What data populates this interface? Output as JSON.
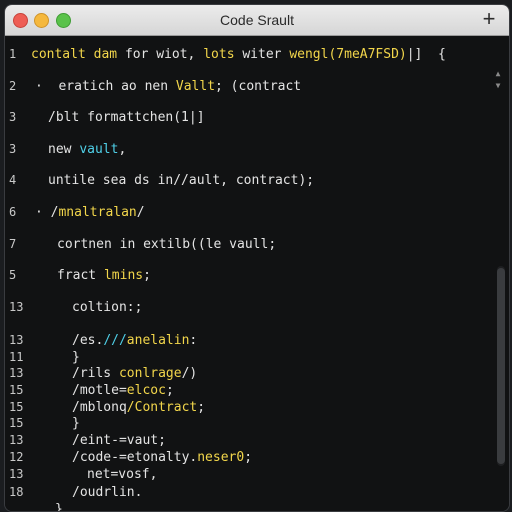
{
  "window": {
    "title": "Code Srault",
    "new_tab_label": "+"
  },
  "editor": {
    "lines": [
      {
        "num": "1",
        "tokens": [
          {
            "t": "contalt ",
            "c": "y"
          },
          {
            "t": "dam ",
            "c": "y"
          },
          {
            "t": "for ",
            "c": "w"
          },
          {
            "t": "wiot, ",
            "c": "w"
          },
          {
            "t": "lots ",
            "c": "y"
          },
          {
            "t": "witer ",
            "c": "w"
          },
          {
            "t": "wengl(7meA7FSD)",
            "c": "y"
          },
          {
            "t": "|]  {",
            "c": "w"
          }
        ]
      },
      {
        "num": "2",
        "tokens": [
          {
            "t": "·  ",
            "c": "w"
          },
          {
            "t": "eratich ao nen ",
            "c": "w"
          },
          {
            "t": "Vallt",
            "c": "y"
          },
          {
            "t": "; (contract",
            "c": "w"
          }
        ]
      },
      {
        "num": "3",
        "tokens": [
          {
            "t": "/blt formattchen(1|]",
            "c": "w"
          }
        ]
      },
      {
        "num": "3",
        "tokens": [
          {
            "t": "new ",
            "c": "w"
          },
          {
            "t": "vault",
            "c": "c"
          },
          {
            "t": ",",
            "c": "w"
          }
        ]
      },
      {
        "num": "4",
        "tokens": [
          {
            "t": "untile sea ds in//ault, contract);",
            "c": "w"
          }
        ]
      },
      {
        "num": "6",
        "tokens": [
          {
            "t": "· /",
            "c": "w"
          },
          {
            "t": "mnaltralan",
            "c": "y"
          },
          {
            "t": "/",
            "c": "w"
          }
        ]
      },
      {
        "num": "7",
        "tokens": [
          {
            "t": "cortnen in extilb((le vaull;",
            "c": "w"
          }
        ]
      },
      {
        "num": "5",
        "tokens": [
          {
            "t": "fract ",
            "c": "w"
          },
          {
            "t": "lmins",
            "c": "y"
          },
          {
            "t": ";",
            "c": "w"
          }
        ]
      },
      {
        "num": "13",
        "tokens": [
          {
            "t": "coltion:;",
            "c": "w"
          }
        ]
      },
      {
        "num": "13",
        "tokens": [
          {
            "t": "/es.",
            "c": "w"
          },
          {
            "t": "///",
            "c": "c"
          },
          {
            "t": "anelalin",
            "c": "y"
          },
          {
            "t": ":",
            "c": "w"
          }
        ]
      },
      {
        "num": "11",
        "tokens": [
          {
            "t": "}",
            "c": "w"
          }
        ]
      },
      {
        "num": "13",
        "tokens": [
          {
            "t": "/rils ",
            "c": "w"
          },
          {
            "t": "conlrage",
            "c": "y"
          },
          {
            "t": "/)",
            "c": "w"
          }
        ]
      },
      {
        "num": "15",
        "tokens": [
          {
            "t": "/motle",
            "c": "w"
          },
          {
            "t": "=",
            "c": "w"
          },
          {
            "t": "elcoc",
            "c": "y"
          },
          {
            "t": ";",
            "c": "w"
          }
        ]
      },
      {
        "num": "15",
        "tokens": [
          {
            "t": "/mblonq",
            "c": "w"
          },
          {
            "t": "/Contract",
            "c": "y"
          },
          {
            "t": ";",
            "c": "w"
          }
        ]
      },
      {
        "num": "15",
        "tokens": [
          {
            "t": "}",
            "c": "w"
          }
        ]
      },
      {
        "num": "13",
        "tokens": [
          {
            "t": "/eint-=vaut;",
            "c": "w"
          }
        ]
      },
      {
        "num": "12",
        "tokens": [
          {
            "t": "/code-=etonalty.",
            "c": "w"
          },
          {
            "t": "neser0",
            "c": "y"
          },
          {
            "t": ";",
            "c": "w"
          }
        ]
      },
      {
        "num": "13",
        "tokens": [
          {
            "t": "net=vosf,",
            "c": "w"
          }
        ]
      },
      {
        "num": "18",
        "tokens": [
          {
            "t": "/oudrlin.",
            "c": "w"
          }
        ]
      },
      {
        "num": "",
        "tokens": [
          {
            "t": "}",
            "c": "w"
          }
        ]
      }
    ]
  },
  "colors": {
    "keyword": "#f2d64b",
    "identifier": "#4fd0e8",
    "text": "#e4e4e4"
  }
}
